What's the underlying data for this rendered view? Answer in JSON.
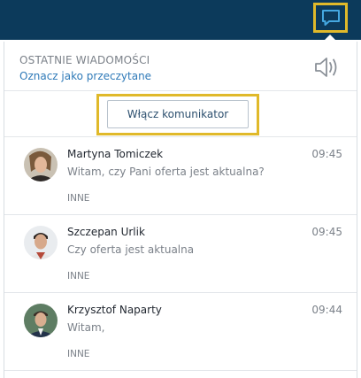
{
  "topbar": {
    "messages_icon": "chat-bubble-icon",
    "accent_color": "#e0b92a",
    "background_color": "#0c3a5b"
  },
  "notifications": {
    "title": "OSTATNIE WIADOMOŚCI",
    "mark_read_label": "Oznacz jako przeczytane",
    "sound_icon": "speaker-icon",
    "enable_button_label": "Włącz komunikator",
    "items": [
      {
        "name": "Martyna Tomiczek",
        "time": "09:45",
        "preview": "Witam, czy Pani oferta jest aktualna?",
        "tag": "INNE"
      },
      {
        "name": "Szczepan Urlik",
        "time": "09:45",
        "preview": "Czy oferta jest aktualna",
        "tag": "INNE"
      },
      {
        "name": "Krzysztof Naparty",
        "time": "09:44",
        "preview": "Witam,",
        "tag": "INNE"
      }
    ]
  }
}
